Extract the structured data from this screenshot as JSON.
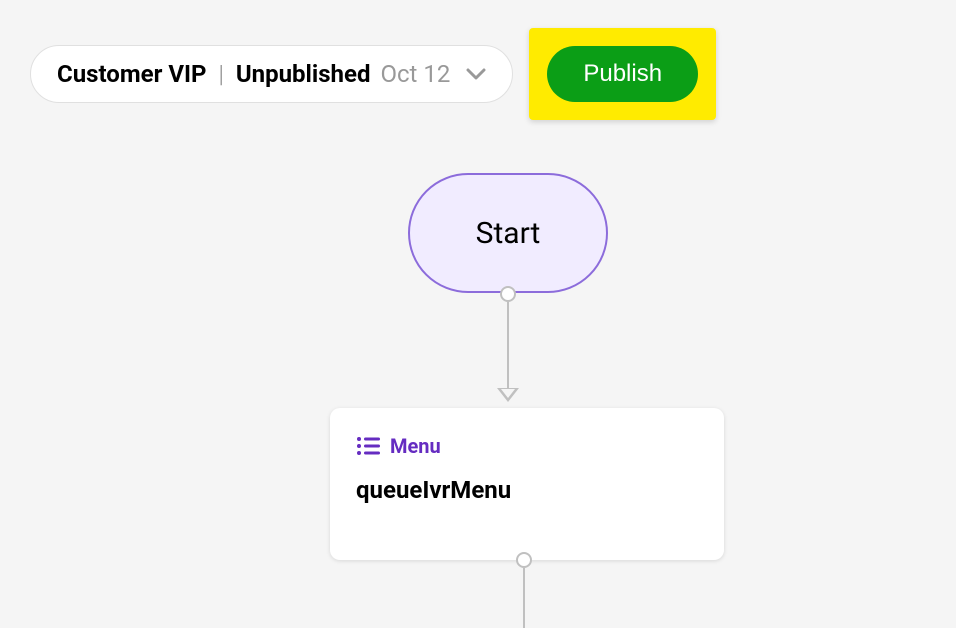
{
  "header": {
    "flow_name": "Customer VIP",
    "flow_status": "Unpublished",
    "flow_date": "Oct 12",
    "publish_label": "Publish"
  },
  "nodes": {
    "start": {
      "label": "Start"
    },
    "menu": {
      "type_label": "Menu",
      "title": "queueIvrMenu"
    }
  }
}
